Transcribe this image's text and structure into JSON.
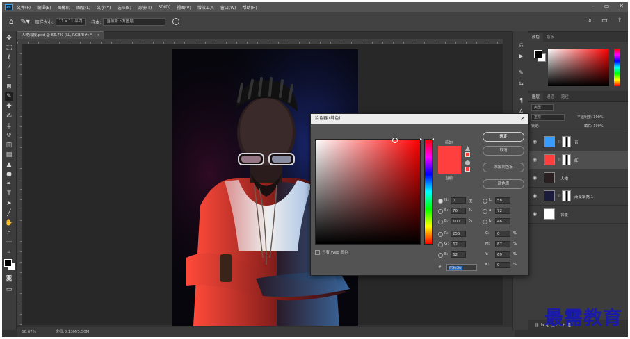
{
  "menu": [
    "文件(F)",
    "编辑(E)",
    "图像(I)",
    "图层(L)",
    "文字(Y)",
    "选择(S)",
    "滤镜(T)",
    "3D(D)",
    "视图(V)",
    "增效工具",
    "窗口(W)",
    "帮助(H)"
  ],
  "app_logo": "Ps",
  "options_bar": {
    "sample_size_label": "取样大小:",
    "sample_size_value": "11 x 11 平均",
    "sample_label": "样本:",
    "sample_value": "当前和下方图层"
  },
  "document_tab": {
    "name": "人物海报.psd @ 66.7% (红, RGB/8#) *",
    "close": "×"
  },
  "status_bar": {
    "zoom": "66.67%",
    "doc_size": "文档:3.13M/5.50M"
  },
  "panels": {
    "color_tabs": [
      "颜色",
      "色板"
    ],
    "layer_tabs": [
      "图层",
      "通道",
      "路径"
    ],
    "filter_label": "类型",
    "blend_mode": "正常",
    "opacity_label": "不透明度: 100%",
    "lock_label": "锁定:",
    "fill_label": "填充: 100%"
  },
  "layers": [
    {
      "name": "青",
      "thumb_color": "#3a9bff",
      "has_mask": true,
      "selected": false
    },
    {
      "name": "红",
      "thumb_color": "#ff3e3e",
      "has_mask": true,
      "selected": true
    },
    {
      "name": "人物",
      "thumb_color": "#2a2020",
      "has_mask": false,
      "selected": false
    },
    {
      "name": "渐变填充 1",
      "thumb_color": "#1a1a3a",
      "has_mask": true,
      "selected": false
    },
    {
      "name": "背景",
      "thumb_color": "#ffffff",
      "has_mask": false,
      "selected": false
    }
  ],
  "dialog": {
    "title": "拾色器 (纯色)",
    "close": "×",
    "new_label": "新的",
    "current_label": "当前",
    "selected_color": "#ff3e3e",
    "buttons": {
      "ok": "确定",
      "cancel": "取消",
      "add_to_swatches": "添加到色板",
      "color_libraries": "颜色库"
    },
    "fields": {
      "H": {
        "value": "0",
        "unit": "度"
      },
      "S": {
        "value": "76",
        "unit": "%"
      },
      "B": {
        "value": "100",
        "unit": "%"
      },
      "R": {
        "value": "255",
        "unit": ""
      },
      "G": {
        "value": "62",
        "unit": ""
      },
      "B2": {
        "value": "62",
        "unit": ""
      },
      "L": {
        "value": "58",
        "unit": ""
      },
      "a": {
        "value": "72",
        "unit": ""
      },
      "b": {
        "value": "46",
        "unit": ""
      },
      "C": {
        "value": "0",
        "unit": "%"
      },
      "M": {
        "value": "87",
        "unit": "%"
      },
      "Y": {
        "value": "69",
        "unit": "%"
      },
      "K": {
        "value": "0",
        "unit": "%"
      }
    },
    "web_only_label": "只有 Web 颜色",
    "hex_label": "#",
    "hex_value": "ff3e3e"
  },
  "watermark": "最需教育"
}
